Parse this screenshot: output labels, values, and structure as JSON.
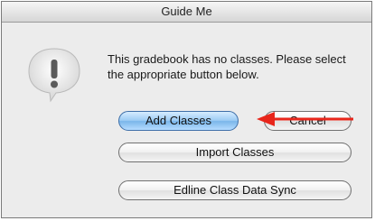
{
  "window": {
    "title": "Guide Me"
  },
  "alert": {
    "icon": "exclamation-icon",
    "message": "This gradebook has no classes. Please select the appropriate button below."
  },
  "buttons": {
    "add_classes": "Add Classes",
    "cancel": "Cancel",
    "import_classes": "Import Classes",
    "edline_sync": "Edline Class Data Sync"
  },
  "annotation": {
    "arrow_color": "#e8261b"
  }
}
